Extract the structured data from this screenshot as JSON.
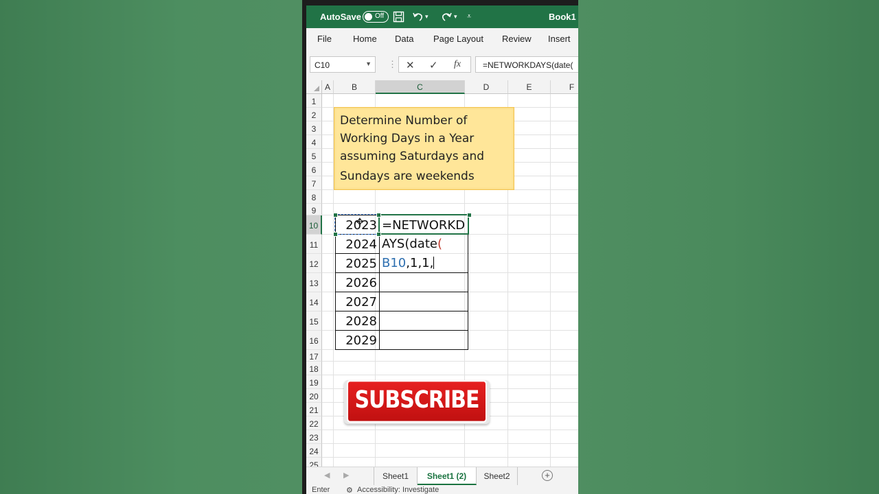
{
  "titlebar": {
    "autosave_label": "AutoSave",
    "autosave_state": "Off",
    "doc_title": "Book1",
    "icons": [
      "save-icon",
      "undo-icon",
      "redo-icon",
      "customize-icon"
    ],
    "accent_color": "#217346"
  },
  "menu": {
    "items": [
      "File",
      "Home",
      "Data",
      "Page Layout",
      "Review",
      "Insert"
    ]
  },
  "formula_bar": {
    "name_box": "C10",
    "cancel_glyph": "✕",
    "enter_glyph": "✓",
    "fx_label": "fx",
    "formula_text": "=NETWORKDAYS(date("
  },
  "grid": {
    "columns": [
      "A",
      "B",
      "C",
      "D",
      "E",
      "F"
    ],
    "rows": [
      "1",
      "2",
      "3",
      "4",
      "5",
      "6",
      "7",
      "8",
      "9",
      "10",
      "11",
      "12",
      "13",
      "14",
      "15",
      "16",
      "17",
      "18",
      "19",
      "20",
      "21",
      "22",
      "23",
      "24",
      "25"
    ],
    "selected_column": "C",
    "selected_row": "10"
  },
  "note": {
    "lines": [
      "Determine Number of",
      "Working Days in a Year",
      "assuming Saturdays and",
      "Sundays are weekends"
    ]
  },
  "table": {
    "years": [
      "2023",
      "2024",
      "2025",
      "2026",
      "2027",
      "2028",
      "2029"
    ],
    "formula_line1": "=NETWORKD",
    "formula_line2_a": "AYS(date",
    "formula_line2_b": "(",
    "formula_line3_a": "B10",
    "formula_line3_b": ",1,1,"
  },
  "subscribe": {
    "label": "SUBSCRIBE"
  },
  "sheets": {
    "tabs": [
      "Sheet1",
      "Sheet1 (2)",
      "Sheet2"
    ],
    "active": "Sheet1 (2)",
    "add_glyph": "+"
  },
  "status": {
    "mode": "Enter",
    "accessibility": "Accessibility: Investigate"
  }
}
